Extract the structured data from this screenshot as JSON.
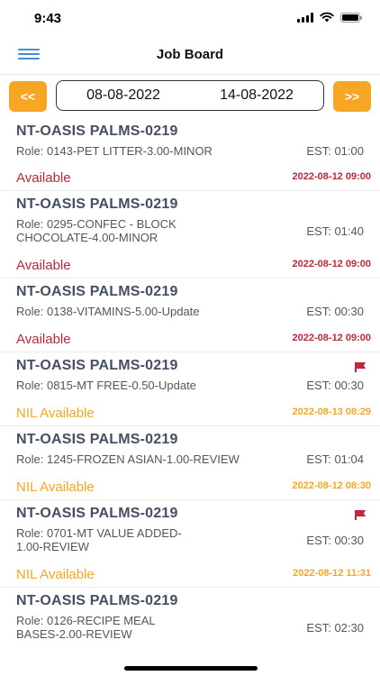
{
  "status_bar": {
    "time": "9:43"
  },
  "header": {
    "title": "Job Board"
  },
  "date_range": {
    "prev_label": "<<",
    "next_label": ">>",
    "start": "08-08-2022",
    "end": "14-08-2022"
  },
  "colors": {
    "accent": "#f6a623",
    "available": "#c0263c",
    "nil_available": "#f6a623",
    "title": "#454f63"
  },
  "jobs": [
    {
      "title": "NT-OASIS PALMS-0219",
      "role": "Role: 0143-PET LITTER-3.00-MINOR",
      "est": "EST: 01:00",
      "status": "Available",
      "datetime": "2022-08-12 09:00",
      "flag": false
    },
    {
      "title": "NT-OASIS PALMS-0219",
      "role": "Role: 0295-CONFEC - BLOCK CHOCOLATE-4.00-MINOR",
      "est": "EST: 01:40",
      "status": "Available",
      "datetime": "2022-08-12 09:00",
      "flag": false
    },
    {
      "title": "NT-OASIS PALMS-0219",
      "role": "Role: 0138-VITAMINS-5.00-Update",
      "est": "EST: 00:30",
      "status": "Available",
      "datetime": "2022-08-12 09:00",
      "flag": false
    },
    {
      "title": "NT-OASIS PALMS-0219",
      "role": "Role: 0815-MT FREE-0.50-Update",
      "est": "EST: 00:30",
      "status": "NIL Available",
      "datetime": "2022-08-13 08:29",
      "flag": true
    },
    {
      "title": "NT-OASIS PALMS-0219",
      "role": "Role: 1245-FROZEN ASIAN-1.00-REVIEW",
      "est": "EST: 01:04",
      "status": "NIL Available",
      "datetime": "2022-08-12 08:30",
      "flag": false
    },
    {
      "title": "NT-OASIS PALMS-0219",
      "role": "Role: 0701-MT VALUE ADDED-1.00-REVIEW",
      "est": "EST: 00:30",
      "status": "NIL Available",
      "datetime": "2022-08-12 11:31",
      "flag": true
    },
    {
      "title": "NT-OASIS PALMS-0219",
      "role": "Role: 0126-RECIPE MEAL BASES-2.00-REVIEW",
      "est": "EST: 02:30",
      "status": "",
      "datetime": "",
      "flag": false
    }
  ]
}
